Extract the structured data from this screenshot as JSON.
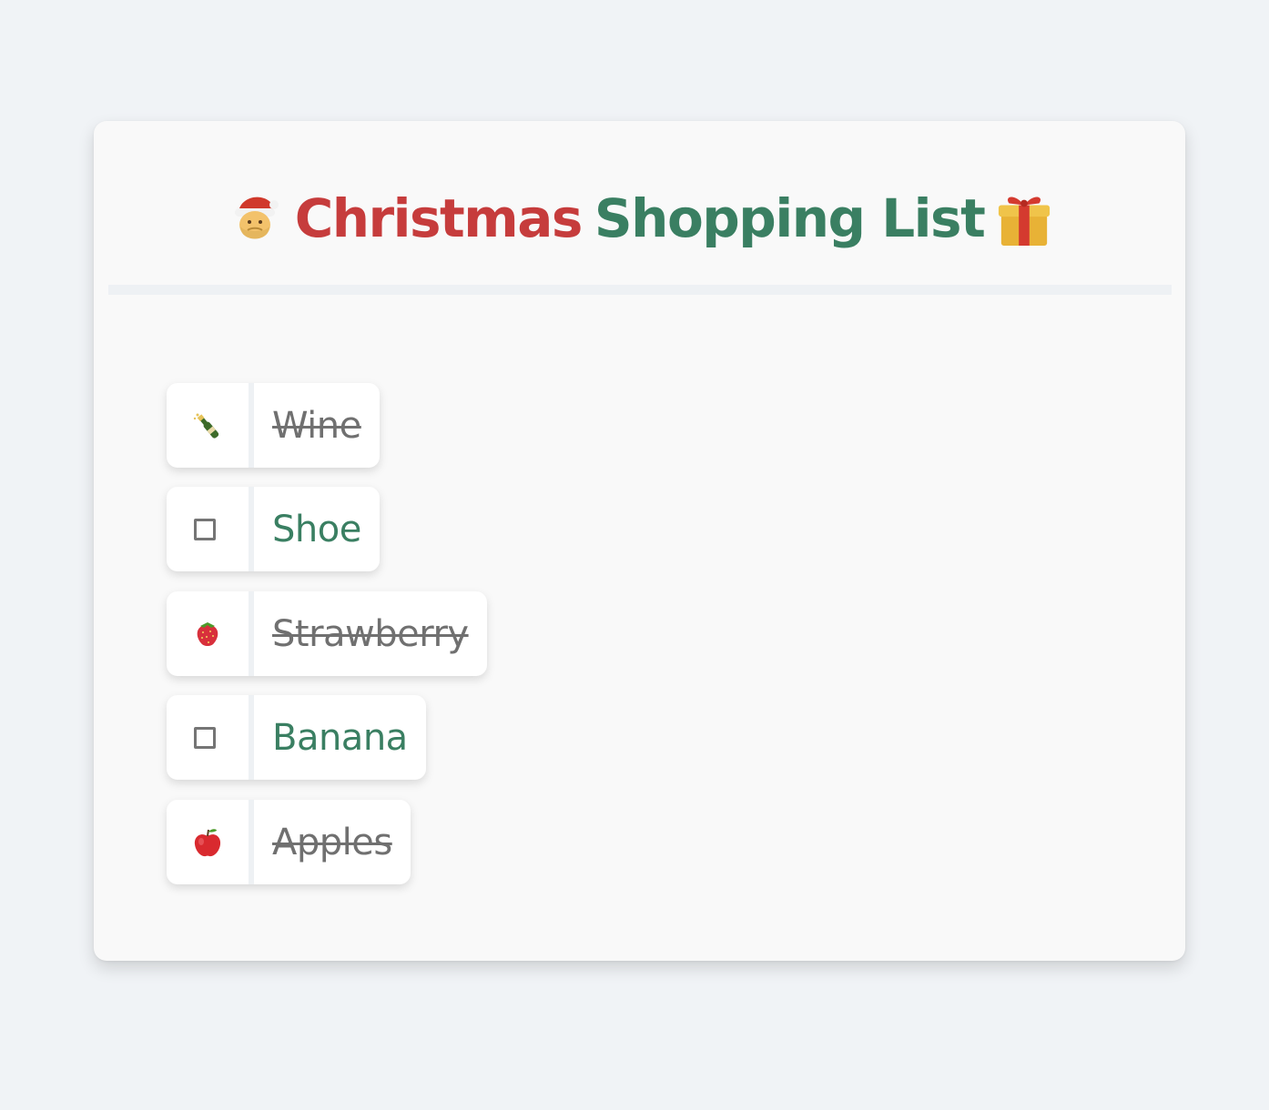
{
  "header": {
    "title_part1": "Christmas",
    "title_part2": "Shopping List",
    "left_icon": "santa-icon",
    "right_icon": "gift-icon",
    "colors": {
      "red": "#c63c3c",
      "green": "#3a7f62"
    }
  },
  "items": [
    {
      "label": "Wine",
      "checked": true,
      "icon": "champagne-bottle-icon"
    },
    {
      "label": "Shoe",
      "checked": false,
      "icon": "checkbox-icon"
    },
    {
      "label": "Strawberry",
      "checked": true,
      "icon": "strawberry-icon"
    },
    {
      "label": "Banana",
      "checked": false,
      "icon": "checkbox-icon"
    },
    {
      "label": "Apples",
      "checked": true,
      "icon": "apple-icon"
    }
  ]
}
